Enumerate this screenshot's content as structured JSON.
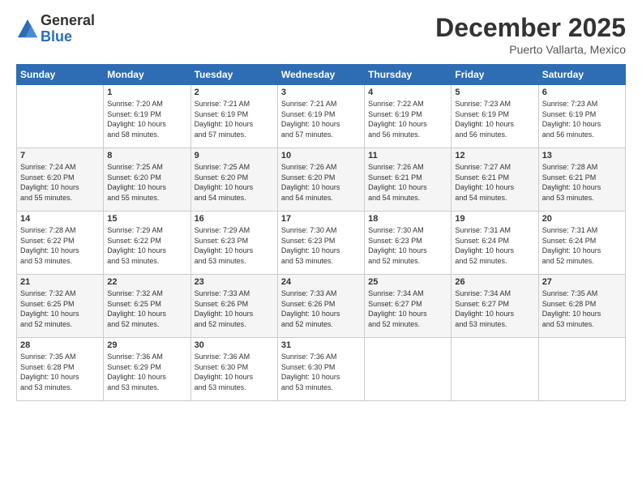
{
  "logo": {
    "general": "General",
    "blue": "Blue"
  },
  "title": "December 2025",
  "subtitle": "Puerto Vallarta, Mexico",
  "days_of_week": [
    "Sunday",
    "Monday",
    "Tuesday",
    "Wednesday",
    "Thursday",
    "Friday",
    "Saturday"
  ],
  "weeks": [
    [
      {
        "day": "",
        "info": ""
      },
      {
        "day": "1",
        "info": "Sunrise: 7:20 AM\nSunset: 6:19 PM\nDaylight: 10 hours\nand 58 minutes."
      },
      {
        "day": "2",
        "info": "Sunrise: 7:21 AM\nSunset: 6:19 PM\nDaylight: 10 hours\nand 57 minutes."
      },
      {
        "day": "3",
        "info": "Sunrise: 7:21 AM\nSunset: 6:19 PM\nDaylight: 10 hours\nand 57 minutes."
      },
      {
        "day": "4",
        "info": "Sunrise: 7:22 AM\nSunset: 6:19 PM\nDaylight: 10 hours\nand 56 minutes."
      },
      {
        "day": "5",
        "info": "Sunrise: 7:23 AM\nSunset: 6:19 PM\nDaylight: 10 hours\nand 56 minutes."
      },
      {
        "day": "6",
        "info": "Sunrise: 7:23 AM\nSunset: 6:19 PM\nDaylight: 10 hours\nand 56 minutes."
      }
    ],
    [
      {
        "day": "7",
        "info": "Sunrise: 7:24 AM\nSunset: 6:20 PM\nDaylight: 10 hours\nand 55 minutes."
      },
      {
        "day": "8",
        "info": "Sunrise: 7:25 AM\nSunset: 6:20 PM\nDaylight: 10 hours\nand 55 minutes."
      },
      {
        "day": "9",
        "info": "Sunrise: 7:25 AM\nSunset: 6:20 PM\nDaylight: 10 hours\nand 54 minutes."
      },
      {
        "day": "10",
        "info": "Sunrise: 7:26 AM\nSunset: 6:20 PM\nDaylight: 10 hours\nand 54 minutes."
      },
      {
        "day": "11",
        "info": "Sunrise: 7:26 AM\nSunset: 6:21 PM\nDaylight: 10 hours\nand 54 minutes."
      },
      {
        "day": "12",
        "info": "Sunrise: 7:27 AM\nSunset: 6:21 PM\nDaylight: 10 hours\nand 54 minutes."
      },
      {
        "day": "13",
        "info": "Sunrise: 7:28 AM\nSunset: 6:21 PM\nDaylight: 10 hours\nand 53 minutes."
      }
    ],
    [
      {
        "day": "14",
        "info": "Sunrise: 7:28 AM\nSunset: 6:22 PM\nDaylight: 10 hours\nand 53 minutes."
      },
      {
        "day": "15",
        "info": "Sunrise: 7:29 AM\nSunset: 6:22 PM\nDaylight: 10 hours\nand 53 minutes."
      },
      {
        "day": "16",
        "info": "Sunrise: 7:29 AM\nSunset: 6:23 PM\nDaylight: 10 hours\nand 53 minutes."
      },
      {
        "day": "17",
        "info": "Sunrise: 7:30 AM\nSunset: 6:23 PM\nDaylight: 10 hours\nand 53 minutes."
      },
      {
        "day": "18",
        "info": "Sunrise: 7:30 AM\nSunset: 6:23 PM\nDaylight: 10 hours\nand 52 minutes."
      },
      {
        "day": "19",
        "info": "Sunrise: 7:31 AM\nSunset: 6:24 PM\nDaylight: 10 hours\nand 52 minutes."
      },
      {
        "day": "20",
        "info": "Sunrise: 7:31 AM\nSunset: 6:24 PM\nDaylight: 10 hours\nand 52 minutes."
      }
    ],
    [
      {
        "day": "21",
        "info": "Sunrise: 7:32 AM\nSunset: 6:25 PM\nDaylight: 10 hours\nand 52 minutes."
      },
      {
        "day": "22",
        "info": "Sunrise: 7:32 AM\nSunset: 6:25 PM\nDaylight: 10 hours\nand 52 minutes."
      },
      {
        "day": "23",
        "info": "Sunrise: 7:33 AM\nSunset: 6:26 PM\nDaylight: 10 hours\nand 52 minutes."
      },
      {
        "day": "24",
        "info": "Sunrise: 7:33 AM\nSunset: 6:26 PM\nDaylight: 10 hours\nand 52 minutes."
      },
      {
        "day": "25",
        "info": "Sunrise: 7:34 AM\nSunset: 6:27 PM\nDaylight: 10 hours\nand 52 minutes."
      },
      {
        "day": "26",
        "info": "Sunrise: 7:34 AM\nSunset: 6:27 PM\nDaylight: 10 hours\nand 53 minutes."
      },
      {
        "day": "27",
        "info": "Sunrise: 7:35 AM\nSunset: 6:28 PM\nDaylight: 10 hours\nand 53 minutes."
      }
    ],
    [
      {
        "day": "28",
        "info": "Sunrise: 7:35 AM\nSunset: 6:28 PM\nDaylight: 10 hours\nand 53 minutes."
      },
      {
        "day": "29",
        "info": "Sunrise: 7:36 AM\nSunset: 6:29 PM\nDaylight: 10 hours\nand 53 minutes."
      },
      {
        "day": "30",
        "info": "Sunrise: 7:36 AM\nSunset: 6:30 PM\nDaylight: 10 hours\nand 53 minutes."
      },
      {
        "day": "31",
        "info": "Sunrise: 7:36 AM\nSunset: 6:30 PM\nDaylight: 10 hours\nand 53 minutes."
      },
      {
        "day": "",
        "info": ""
      },
      {
        "day": "",
        "info": ""
      },
      {
        "day": "",
        "info": ""
      }
    ]
  ]
}
